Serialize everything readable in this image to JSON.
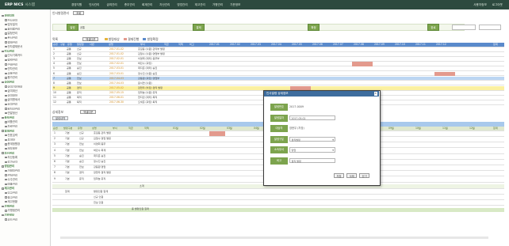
{
  "header": {
    "logo": "ERP NICS",
    "logo_sub": "시스템",
    "nav": [
      "경영지원",
      "인사관리",
      "급여관리",
      "총무관리",
      "회계관리",
      "자산관리",
      "영업관리",
      "재고관리",
      "가맹관리",
      "기준정보"
    ],
    "right": [
      "사용자정보",
      "로그아웃"
    ]
  },
  "sidebar": {
    "items": [
      {
        "label": "경영지원",
        "group": true
      },
      {
        "label": "전사공지",
        "group": false
      },
      {
        "label": "업무일지",
        "group": false
      },
      {
        "label": "회의록관리",
        "group": false
      },
      {
        "label": "일정관리",
        "group": false
      },
      {
        "label": "문서관리",
        "group": false
      },
      {
        "label": "결재관리",
        "group": false
      },
      {
        "label": "전자결재문서",
        "group": false
      },
      {
        "label": "인사관리",
        "group": true
      },
      {
        "label": "인사기록카드",
        "group": false
      },
      {
        "label": "발령관리",
        "group": false
      },
      {
        "label": "근태관리",
        "group": false
      },
      {
        "label": "연차관리",
        "group": false
      },
      {
        "label": "교육관리",
        "group": false
      },
      {
        "label": "평가관리",
        "group": false
      },
      {
        "label": "급여관리",
        "group": true
      },
      {
        "label": "급여기본정보",
        "group": false
      },
      {
        "label": "급여계산",
        "group": false
      },
      {
        "label": "급여대장",
        "group": false
      },
      {
        "label": "급여명세서",
        "group": false
      },
      {
        "label": "상여관리",
        "group": false
      },
      {
        "label": "퇴직금관리",
        "group": false
      },
      {
        "label": "연말정산",
        "group": false
      },
      {
        "label": "총무관리",
        "group": true
      },
      {
        "label": "비품관리",
        "group": false
      },
      {
        "label": "차량관리",
        "group": false
      },
      {
        "label": "회계관리",
        "group": true
      },
      {
        "label": "전표입력",
        "group": false
      },
      {
        "label": "분개장",
        "group": false
      },
      {
        "label": "총계정원장",
        "group": false
      },
      {
        "label": "재무제표",
        "group": false
      },
      {
        "label": "자산관리",
        "group": true
      },
      {
        "label": "자산등록",
        "group": false
      },
      {
        "label": "감가상각",
        "group": false
      },
      {
        "label": "영업관리",
        "group": true
      },
      {
        "label": "거래처관리",
        "group": false
      },
      {
        "label": "견적관리",
        "group": false
      },
      {
        "label": "수주관리",
        "group": false
      },
      {
        "label": "매출관리",
        "group": false
      },
      {
        "label": "재고관리",
        "group": true
      },
      {
        "label": "입고관리",
        "group": false
      },
      {
        "label": "출고관리",
        "group": false
      },
      {
        "label": "재고현황",
        "group": false
      },
      {
        "label": "가맹관리",
        "group": true
      },
      {
        "label": "가맹점관리",
        "group": false
      },
      {
        "label": "기준정보",
        "group": true
      },
      {
        "label": "코드관리",
        "group": false
      }
    ]
  },
  "top_section": {
    "title": "인사발령관리",
    "title_btn": "조회",
    "filter_label": "발령",
    "filter_select": "공통",
    "step_buttons": [
      "발령",
      "결재",
      "확정",
      "완료"
    ],
    "list_label": "목록",
    "list_btn": "엑셀다운",
    "legend": [
      "발령대상",
      "결재진행",
      "발령확정"
    ],
    "columns": [
      "순번",
      "구분",
      "유형",
      "발령일",
      "사번",
      "성명",
      "부서",
      "직급",
      "직책",
      "비고",
      "2017.01",
      "2017.02",
      "2017.03",
      "2017.04",
      "2017.05",
      "2017.06",
      "2017.07",
      "2017.08",
      "2017.09",
      "2017.10",
      "2017.11",
      "2017.12",
      "합계"
    ],
    "rows": [
      {
        "no": "1",
        "type": "공통",
        "kind": "신규",
        "date": "2017-01-02",
        "name": "홍길동 (사원) 관리부 발령",
        "style": ""
      },
      {
        "no": "2",
        "type": "공통",
        "kind": "신규",
        "date": "2017-01-02",
        "name": "김철수 (사원) 영업부 발령",
        "style": ""
      },
      {
        "no": "3",
        "type": "공통",
        "kind": "전보",
        "date": "2017-02-01",
        "name": "이영희 (대리) 총무부",
        "style": ""
      },
      {
        "no": "4",
        "type": "공통",
        "kind": "전보",
        "date": "2017-02-01",
        "name": "박민수 (과장)",
        "style": ""
      },
      {
        "no": "5",
        "type": "공통",
        "kind": "승진",
        "date": "2017-03-01",
        "name": "최지훈 (대리) 승진",
        "style": ""
      },
      {
        "no": "6",
        "type": "공통",
        "kind": "승진",
        "date": "2017-03-01",
        "name": "정수진 (사원) 승진",
        "style": ""
      },
      {
        "no": "7",
        "type": "공통",
        "kind": "전보",
        "date": "2017-04-03",
        "name": "강동원 (과장) 영업부",
        "style": "blue"
      },
      {
        "no": "8",
        "type": "공통",
        "kind": "전보",
        "date": "2017-04-03",
        "name": "윤서연 (사원)",
        "style": ""
      },
      {
        "no": "9",
        "type": "공통",
        "kind": "겸직",
        "date": "2017-05-02",
        "name": "장현우 (차장) 겸직 발령",
        "style": "yellow"
      },
      {
        "no": "10",
        "type": "공통",
        "kind": "휴직",
        "date": "2017-05-15",
        "name": "임하늘 (사원) 휴직",
        "style": ""
      },
      {
        "no": "11",
        "type": "공통",
        "kind": "복직",
        "date": "2017-06-01",
        "name": "한지민 (대리) 복직",
        "style": ""
      },
      {
        "no": "12",
        "type": "공통",
        "kind": "퇴직",
        "date": "2017-06-30",
        "name": "오세훈 (과장) 퇴직",
        "style": ""
      }
    ]
  },
  "bottom_section": {
    "title": "상세정보",
    "title_btn": "엑셀다운",
    "tab": "발령내역",
    "columns": [
      "순번",
      "발령구분",
      "유형",
      "성명",
      "부서",
      "직급",
      "직책",
      "01월",
      "02월",
      "03월",
      "04월",
      "05월",
      "06월",
      "07월",
      "08월",
      "09월",
      "10월",
      "11월",
      "12월",
      "합계"
    ],
    "rows": [
      {
        "no": "1",
        "kind": "기본",
        "type": "신규",
        "name": "홍길동 관리 발령"
      },
      {
        "no": "2",
        "kind": "기본",
        "type": "신규",
        "name": "김철수 영업 발령"
      },
      {
        "no": "3",
        "kind": "기본",
        "type": "전보",
        "name": "이영희 총무"
      },
      {
        "no": "4",
        "kind": "기본",
        "type": "전보",
        "name": "박민수 회계"
      },
      {
        "no": "5",
        "kind": "기본",
        "type": "승진",
        "name": "최지훈 승진"
      },
      {
        "no": "6",
        "kind": "기본",
        "type": "승진",
        "name": "정수진 승진"
      },
      {
        "no": "7",
        "kind": "기본",
        "type": "전보",
        "name": "강동원 영업"
      },
      {
        "no": "8",
        "kind": "기본",
        "type": "겸직",
        "name": "장현우 겸직 발령"
      },
      {
        "no": "9",
        "kind": "기본",
        "type": "휴직",
        "name": "임하늘 휴직"
      }
    ],
    "subtotal_label": "소계",
    "extra_rows": [
      {
        "no": "",
        "kind": "합계",
        "type": "",
        "name": "발령인원 합계"
      },
      {
        "no": "",
        "kind": "",
        "type": "",
        "name": "신규 인원"
      },
      {
        "no": "",
        "kind": "",
        "type": "",
        "name": "전보 인원"
      }
    ],
    "footer_label": "총 발령인원 합계"
  },
  "dialog": {
    "title": "인사발령 상세정보",
    "close": "×",
    "fields": [
      {
        "label": "발령번호",
        "value": "2017-0009",
        "kind": "text"
      },
      {
        "label": "발령일자",
        "value": "2017-05-02",
        "kind": "input"
      },
      {
        "label": "대상자",
        "value": "장현우 (차장)",
        "kind": "text"
      },
      {
        "label": "발령구분",
        "value": "겸직발령",
        "kind": "select"
      },
      {
        "label": "소속부서",
        "value": "영업",
        "kind": "select"
      },
      {
        "label": "비고",
        "value": "겸직 발령",
        "kind": "input"
      }
    ],
    "buttons": [
      "저장",
      "삭제",
      "닫기"
    ]
  }
}
